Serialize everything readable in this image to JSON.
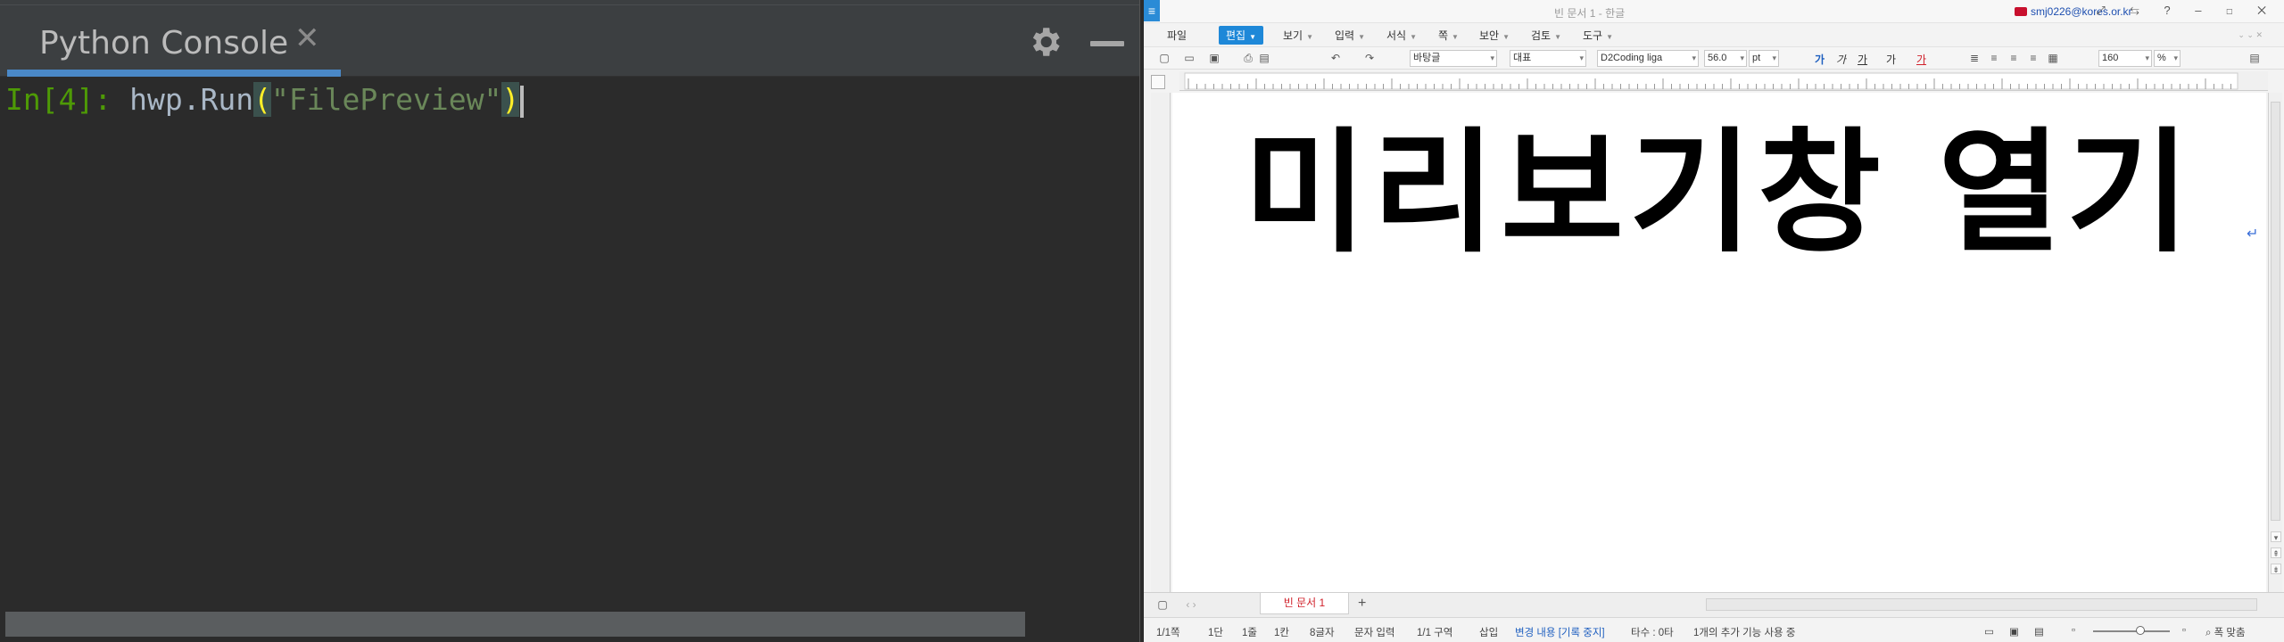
{
  "console": {
    "tab_title": "Python Console",
    "close_glyph": "✕",
    "prompt": "In[4]:",
    "command_prefix": "hwp.Run",
    "open_paren": "(",
    "string_arg": "\"FilePreview\"",
    "close_paren": ")"
  },
  "hwp": {
    "title": "빈 문서 1 - 한글",
    "account": "smj0226@kores.or.kr",
    "menus": [
      {
        "label": "파일"
      },
      {
        "label": "편집",
        "active": true
      },
      {
        "label": "보기"
      },
      {
        "label": "입력"
      },
      {
        "label": "서식"
      },
      {
        "label": "쪽"
      },
      {
        "label": "보안"
      },
      {
        "label": "검토"
      },
      {
        "label": "도구"
      }
    ],
    "toolbar": {
      "style": "바탕글",
      "lang": "대표",
      "font": "D2Coding liga",
      "size": "56.0",
      "size_unit": "pt",
      "line_spacing": "160",
      "line_spacing_unit": "%",
      "format_glyphs": [
        "가",
        "가",
        "가",
        "가",
        "가"
      ]
    },
    "document_text": "미리보기창 열기",
    "doc_tab": "빈 문서 1",
    "status": {
      "page": "1/1쪽",
      "column": "1단",
      "line": "1줄",
      "cell": "1칸",
      "chars": "8글자",
      "input_mode": "문자 입력",
      "section": "1/1 구역",
      "insert": "삽입",
      "track_changes": "변경 내용 [기록 중지]",
      "strokes": "타수 : 0타",
      "addons": "1개의 추가 기능 사용 중",
      "fit": "폭 맞춤"
    },
    "colors": {
      "accent": "#1e88d8",
      "tab_text": "#d0202a"
    }
  },
  "colors": {
    "console_bg": "#2b2b2b",
    "prompt": "#4e9a06",
    "string": "#6a8759",
    "tab_underline": "#4a88c7"
  }
}
